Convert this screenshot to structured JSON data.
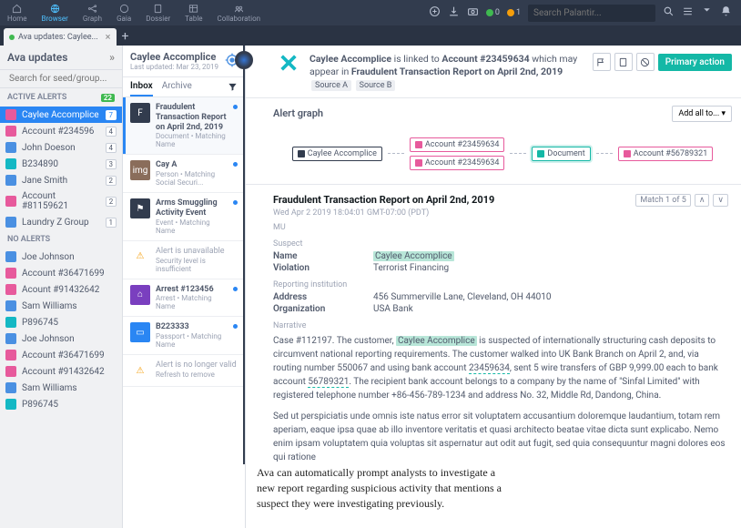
{
  "topnav": {
    "items": [
      {
        "label": "Home",
        "icon": "home-icon"
      },
      {
        "label": "Browser",
        "icon": "browser-icon",
        "active": true
      },
      {
        "label": "Graph",
        "icon": "graph-icon"
      },
      {
        "label": "Gaia",
        "icon": "gaia-icon"
      },
      {
        "label": "Dossier",
        "icon": "dossier-icon"
      },
      {
        "label": "Table",
        "icon": "table-icon"
      },
      {
        "label": "Collaboration",
        "icon": "collab-icon"
      }
    ],
    "notif_green": "0",
    "notif_orange": "1",
    "search_placeholder": "Search Palantir..."
  },
  "tab": {
    "title": "Ava updates: Caylee..."
  },
  "sidebar": {
    "title": "Ava updates",
    "search_placeholder": "Search for seed/group...",
    "active_label": "ACTIVE ALERTS",
    "active_badge": "22",
    "active": [
      {
        "label": "Caylee Accomplice",
        "count": "7",
        "color": "pink",
        "active": true
      },
      {
        "label": "Account #234596",
        "count": "4",
        "color": "pink"
      },
      {
        "label": "John Doeson",
        "count": "4",
        "color": "blue"
      },
      {
        "label": "B234890",
        "count": "3",
        "color": "cyan"
      },
      {
        "label": "Jane Smith",
        "count": "2",
        "color": "blue"
      },
      {
        "label": "Account #81159621",
        "count": "2",
        "color": "pink"
      },
      {
        "label": "Laundry Z Group",
        "count": "1",
        "color": "blue"
      }
    ],
    "noalerts_label": "NO ALERTS",
    "noalerts": [
      {
        "label": "Joe Johnson",
        "color": "blue"
      },
      {
        "label": "Account #36471699",
        "color": "pink"
      },
      {
        "label": "Acount #91432642",
        "color": "pink"
      },
      {
        "label": "Sam Williams",
        "color": "blue"
      },
      {
        "label": "P896745",
        "color": "cyan"
      },
      {
        "label": "Joe Johnson",
        "color": "blue"
      },
      {
        "label": "Account #36471699",
        "color": "pink"
      },
      {
        "label": "Account #91432642",
        "color": "pink"
      },
      {
        "label": "Sam Williams",
        "color": "blue"
      },
      {
        "label": "P896745",
        "color": "cyan"
      }
    ]
  },
  "mid": {
    "title": "Caylee Accomplice",
    "sub": "Last updated: Mar 23, 2019",
    "tab_inbox": "Inbox",
    "tab_archive": "Archive",
    "items": [
      {
        "title": "Fraudulent Transaction Report on April 2nd, 2019",
        "sub": "Document • Matching Name",
        "thumb": "F",
        "thumbBg": "#323c4e",
        "dot": true,
        "selected": true
      },
      {
        "title": "Cay A",
        "sub": "Person • Matching Social Securi...",
        "thumb": "img",
        "thumbBg": "#8a6d5b",
        "dot": true
      },
      {
        "title": "Arms Smuggling Activity Event",
        "sub": "Event • Matching Name",
        "thumb": "⚑",
        "thumbBg": "#323c4e",
        "dot": true
      },
      {
        "title": "Alert is unavailable",
        "sub": "Security level is insufficient",
        "thumb": "⚠",
        "thumbBg": "#fff",
        "warn": true,
        "grey": true
      },
      {
        "title": "Arrest #123456",
        "sub": "Arrest • Matching Name",
        "thumb": "⌂",
        "thumbBg": "#7a3fbf",
        "dot": true
      },
      {
        "title": "B223333",
        "sub": "Passport • Matching Name",
        "thumb": "▭",
        "thumbBg": "#2a86f3",
        "dot": true
      },
      {
        "title": "Alert is no longer valid",
        "sub": "Refresh to remove",
        "thumb": "⚠",
        "thumbBg": "#fff",
        "warn": true,
        "grey": true
      }
    ]
  },
  "content": {
    "header_html": {
      "subject": "Caylee Accomplice",
      "mid1": " is linked to ",
      "acct": "Account #23459634",
      "mid2": " which may appear in ",
      "doc": "Fraudulent Transaction Report on April 2nd, 2019",
      "srcA": "Source A",
      "srcB": "Source B"
    },
    "primary_btn": "Primary action",
    "graph_title": "Alert graph",
    "add_all": "Add all to... ",
    "nodes": {
      "n1": "Caylee Accomplice",
      "n2": "Account #23459634",
      "n3": "Account #23459634",
      "n4": "Document",
      "n5": "Account #56789321"
    },
    "doc_title": "Fraudulent Transaction Report on April 2nd, 2019",
    "doc_date": "Wed Apr 2 2019 18:04:01 GMT-07:00 (PDT)",
    "doc_code": "MU",
    "match": "Match 1 of 5",
    "suspect_label": "Suspect",
    "kv1_k": "Name",
    "kv1_v": "Caylee Accomplice",
    "kv2_k": "Violation",
    "kv2_v": "Terrorist Financing",
    "reporting_label": "Reporting institution",
    "kv3_k": "Address",
    "kv3_v": "456 Summerville Lane, Cleveland, OH 44010",
    "kv4_k": "Organization",
    "kv4_v": "USA Bank",
    "narrative_label": "Narrative",
    "narr1_pre": "Case #112197. The customer, ",
    "narr1_hl": "Caylee Accomplice",
    "narr1_mid": " is suspected of internationally structuring cash deposits to circumvent national reporting requirements. The customer walked into UK Bank Branch on April 2, and, via routing number 550067 and using bank account ",
    "narr1_u1": "23459634",
    "narr1_mid2": ", sent 5 wire transfers of GBP 9,999.00 each to bank account ",
    "narr1_u2": "56789321",
    "narr1_post": ". The recipient bank account belongs to a company by the name of \"Sinfal Limited\" with registered telephone number +86-456-789-1234 and address No. 32, Middle Rd, Dandong, China.",
    "narr2": "Sed ut perspiciatis unde omnis iste natus error sit voluptatem accusantium doloremque laudantium, totam rem aperiam, eaque ipsa quae ab illo inventore veritatis et quasi architecto beatae vitae dicta sunt explicabo. Nemo enim ipsam voluptatem quia voluptas sit aspernatur aut odit aut fugit, sed quia consequuntur magni dolores eos qui ratione"
  },
  "caption": "Ava can automatically prompt analysts to investigate a new report regarding suspicious activity that mentions a suspect they were investigating previously."
}
